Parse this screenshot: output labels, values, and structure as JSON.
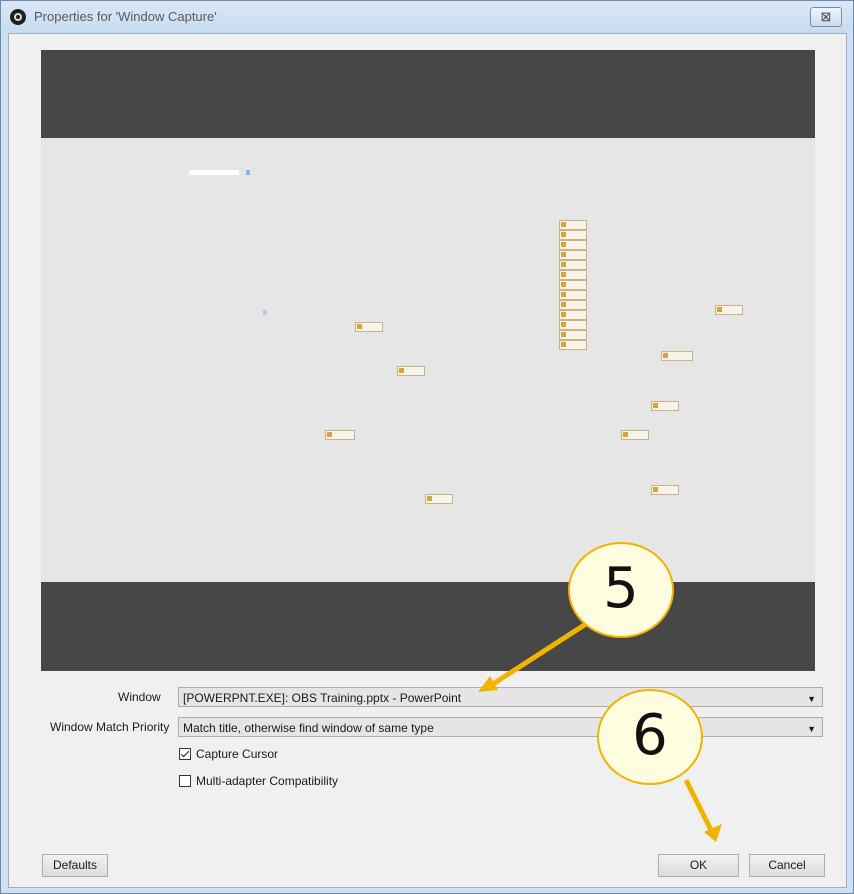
{
  "window": {
    "title": "Properties for 'Window Capture'",
    "close_glyph": "⊠"
  },
  "form": {
    "window_label": "Window",
    "window_value": "[POWERPNT.EXE]: OBS Training.pptx - PowerPoint",
    "priority_label": "Window Match Priority",
    "priority_value": "Match title, otherwise find window of same type",
    "capture_cursor_label": "Capture Cursor",
    "capture_cursor_checked": true,
    "multi_adapter_label": "Multi-adapter Compatibility",
    "multi_adapter_checked": false
  },
  "buttons": {
    "defaults": "Defaults",
    "ok": "OK",
    "cancel": "Cancel"
  },
  "annotations": {
    "step5": "5",
    "step6": "6",
    "color": "#f0b400"
  },
  "icons": {
    "app": "obs-logo-icon",
    "close": "close-icon",
    "dropdown": "chevron-down-icon",
    "checkbox": "checkbox-icon"
  }
}
